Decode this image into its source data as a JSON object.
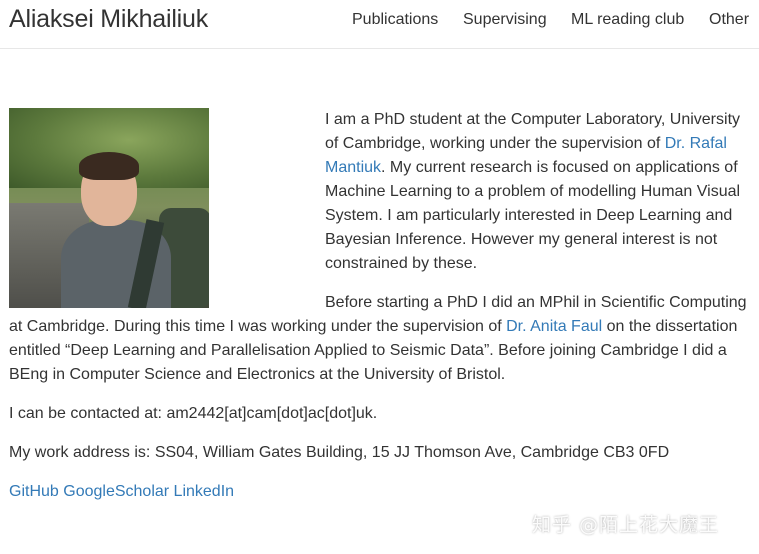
{
  "header": {
    "brand": "Aliaksei Mikhailiuk",
    "nav": [
      "Publications",
      "Supervising",
      "ML reading club",
      "Other"
    ]
  },
  "bio": {
    "p1_a": "I am a PhD student at the Computer Laboratory, University of Cambridge, working under the supervision of ",
    "p1_link": "Dr. Rafal Mantiuk",
    "p1_b": ". My current research is focused on applications of Machine Learning to a problem of modelling Human Visual System. I am particularly interested in Deep Learning and Bayesian Inference. However my general interest is not constrained by these.",
    "p2_a": "Before starting a PhD I did an MPhil in Scientific Computing at Cambridge. During this time I was working under the supervision of ",
    "p2_link": "Dr. Anita Faul",
    "p2_b": " on the dissertation entitled “Deep Learning and Parallelisation Applied to Seismic Data”. Before joining Cambridge I did a BEng in Computer Science and Electronics at the University of Bristol.",
    "contact": "I can be contacted at: am2442[at]cam[dot]ac[dot]uk.",
    "address": "My work address is: SS04, William Gates Building, 15 JJ Thomson Ave, Cambridge CB3 0FD"
  },
  "links": [
    "GitHub",
    "GoogleScholar",
    "LinkedIn"
  ],
  "watermark": "知乎 @陌上花大魔王",
  "colors": {
    "link": "#337ab7",
    "text": "#333333",
    "border": "#e7e7e7"
  }
}
